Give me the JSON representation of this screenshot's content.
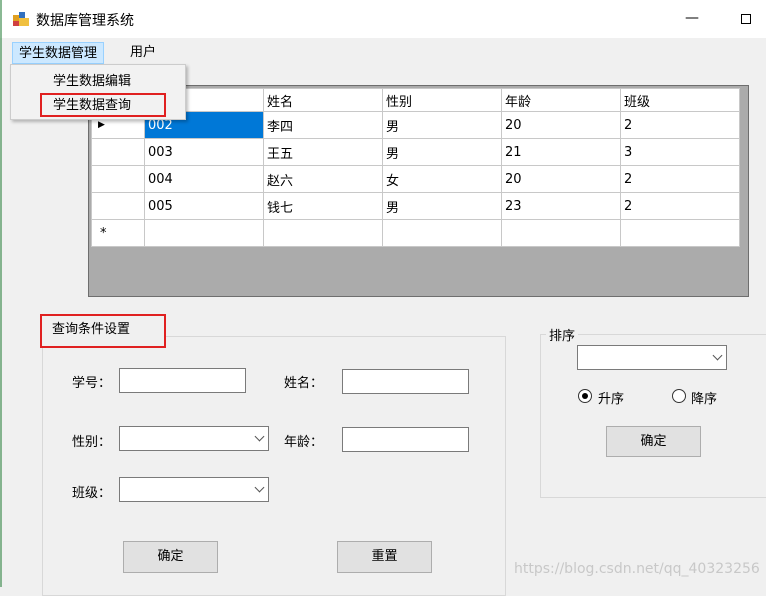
{
  "window": {
    "title": "数据库管理系统",
    "min": "—"
  },
  "menu": {
    "student": "学生数据管理",
    "user": "用户"
  },
  "dropdown": {
    "edit": "学生数据编辑",
    "query": "学生数据查询"
  },
  "grid": {
    "columns": [
      "姓名",
      "性别",
      "年龄",
      "班级"
    ],
    "rows": [
      {
        "id": "002",
        "name": "李四",
        "sex": "男",
        "age": "20",
        "class": "2"
      },
      {
        "id": "003",
        "name": "王五",
        "sex": "男",
        "age": "21",
        "class": "3"
      },
      {
        "id": "004",
        "name": "赵六",
        "sex": "女",
        "age": "20",
        "class": "2"
      },
      {
        "id": "005",
        "name": "钱七",
        "sex": "男",
        "age": "23",
        "class": "2"
      }
    ],
    "current_marker": "▶",
    "new_marker": "*"
  },
  "query": {
    "title": "查询条件设置",
    "id_label": "学号：",
    "name_label": "姓名：",
    "sex_label": "性别：",
    "age_label": "年龄：",
    "class_label": "班级：",
    "confirm": "确定",
    "reset": "重置"
  },
  "sort": {
    "title": "排序",
    "asc": "升序",
    "desc": "降序",
    "confirm": "确定",
    "order": "asc"
  },
  "watermark": "https://blog.csdn.net/qq_40323256"
}
